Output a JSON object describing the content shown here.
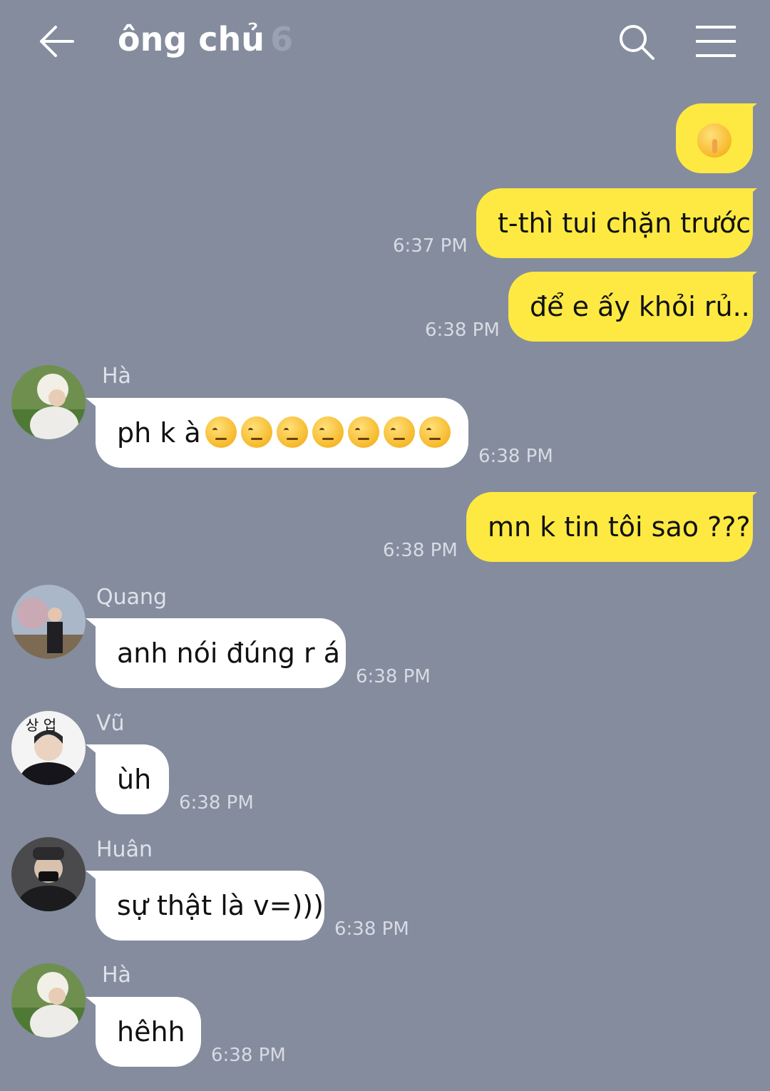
{
  "header": {
    "title": "ông chủ",
    "member_count": "6",
    "back_icon": "arrow-left-icon",
    "search_icon": "search-icon",
    "menu_icon": "hamburger-menu-icon"
  },
  "colors": {
    "background": "#848c9e",
    "outgoing_bubble": "#fde942",
    "incoming_bubble": "#ffffff"
  },
  "messages": [
    {
      "direction": "out",
      "text": "",
      "emoji": "shushing-face-emoji",
      "time": ""
    },
    {
      "direction": "out",
      "text": "t-thì tui chặn trước",
      "time": "6:37 PM"
    },
    {
      "direction": "out",
      "text": "để e ấy khỏi rủ..",
      "time": "6:38 PM"
    },
    {
      "direction": "in",
      "sender": "Hà",
      "text": "ph k à",
      "emoji": "face-with-raised-eyebrow-emoji x7",
      "time": "6:38 PM"
    },
    {
      "direction": "out",
      "text": "mn k tin tôi sao ???",
      "time": "6:38 PM"
    },
    {
      "direction": "in",
      "sender": "Quang",
      "text": "anh nói đúng r á",
      "time": "6:38 PM"
    },
    {
      "direction": "in",
      "sender": "Vũ",
      "text": "ùh",
      "time": "6:38 PM",
      "avatar_text": "상 업"
    },
    {
      "direction": "in",
      "sender": "Huân",
      "text": "sự thật là v=)))",
      "time": "6:38 PM"
    },
    {
      "direction": "in",
      "sender": "Hà",
      "text": "hêhh",
      "time": "6:38 PM"
    }
  ]
}
